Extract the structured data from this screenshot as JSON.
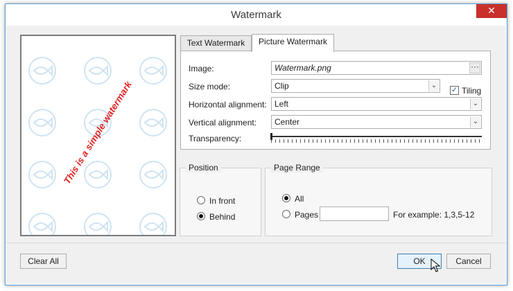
{
  "window": {
    "title": "Watermark",
    "close_glyph": "✕"
  },
  "preview": {
    "watermark_text": "This is a simple watermark",
    "watermark_color": "#e02424",
    "tile_icon": "fish-icon",
    "tile_color": "#cfe3f1"
  },
  "tabs": [
    {
      "label": "Text Watermark",
      "active": false
    },
    {
      "label": "Picture Watermark",
      "active": true
    }
  ],
  "picture": {
    "image_label": "Image:",
    "image_value": "Watermark.png",
    "browse_glyph": "···",
    "size_mode_label": "Size mode:",
    "size_mode_value": "Clip",
    "tiling_label": "Tiling",
    "tiling_checked": true,
    "tiling_glyph": "✓",
    "h_align_label": "Horizontal alignment:",
    "h_align_value": "Left",
    "v_align_label": "Vertical alignment:",
    "v_align_value": "Center",
    "transparency_label": "Transparency:",
    "transparency_value": 0,
    "dropdown_glyph": "⌄"
  },
  "position": {
    "title": "Position",
    "options": [
      {
        "label": "In front",
        "selected": false
      },
      {
        "label": "Behind",
        "selected": true
      }
    ]
  },
  "page_range": {
    "title": "Page Range",
    "all_label": "All",
    "all_selected": true,
    "pages_label": "Pages",
    "pages_value": "",
    "example_text": "For example: 1,3,5-12"
  },
  "buttons": {
    "clear_all": "Clear All",
    "ok": "OK",
    "cancel": "Cancel"
  },
  "colors": {
    "accent_border": "#5a9bd5",
    "close_button": "#c9302c",
    "ok_button_bg": "#e5f1fb"
  }
}
